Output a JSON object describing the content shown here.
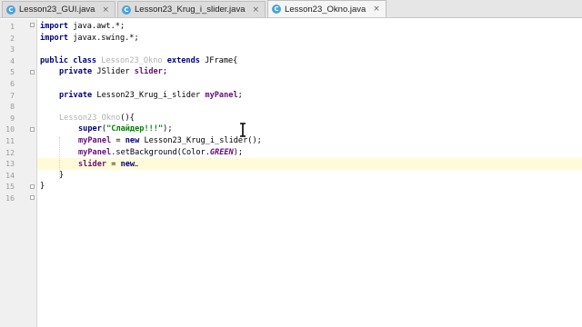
{
  "tabs": [
    {
      "name": "Lesson23_GUI.java",
      "active": false
    },
    {
      "name": "Lesson23_Krug_i_slider.java",
      "active": false
    },
    {
      "name": "Lesson23_Okno.java",
      "active": true
    }
  ],
  "tab_icon_letter": "C",
  "tab_close": "×",
  "line_numbers": [
    "1",
    "2",
    "3",
    "4",
    "5",
    "6",
    "7",
    "8",
    "9",
    "10",
    "11",
    "12",
    "13",
    "14",
    "15",
    "16"
  ],
  "code": {
    "l1_kw": "import",
    "l1_rest": " java.awt.*;",
    "l2_kw": "import",
    "l2_rest": " javax.swing.*;",
    "l4_kw1": "public class",
    "l4_cls": "Lesson23_Okno",
    "l4_kw2": "extends",
    "l4_rest": " JFrame{",
    "l5_kw": "private",
    "l5_rest": " JSlider ",
    "l5_fld": "slider",
    "l5_end": ";",
    "l7_kw": "private",
    "l7_rest": " Lesson23_Krug_i_slider ",
    "l7_fld": "myPanel",
    "l7_end": ";",
    "l9_cls": "Lesson23_Okno",
    "l9_rest": "(){",
    "l10_kw": "super",
    "l10_open": "(",
    "l10_str": "\"Слайдер!!!\"",
    "l10_end": ");",
    "l11_fld": "myPanel",
    "l11_mid": " = ",
    "l11_kw": "new",
    "l11_rest": " Lesson23_Krug_i_slider();",
    "l12_fld": "myPanel",
    "l12_mid": ".setBackground(Color.",
    "l12_cst": "GREEN",
    "l12_end": ");",
    "l13_fld": "slider",
    "l13_mid": " = ",
    "l13_kw": "new",
    "l14": "}",
    "l15": "}"
  },
  "colors": {
    "keyword": "#000080",
    "field": "#660e7a",
    "string": "#008000",
    "unused_class": "#b0b0b0",
    "current_line": "#fffbd8"
  }
}
